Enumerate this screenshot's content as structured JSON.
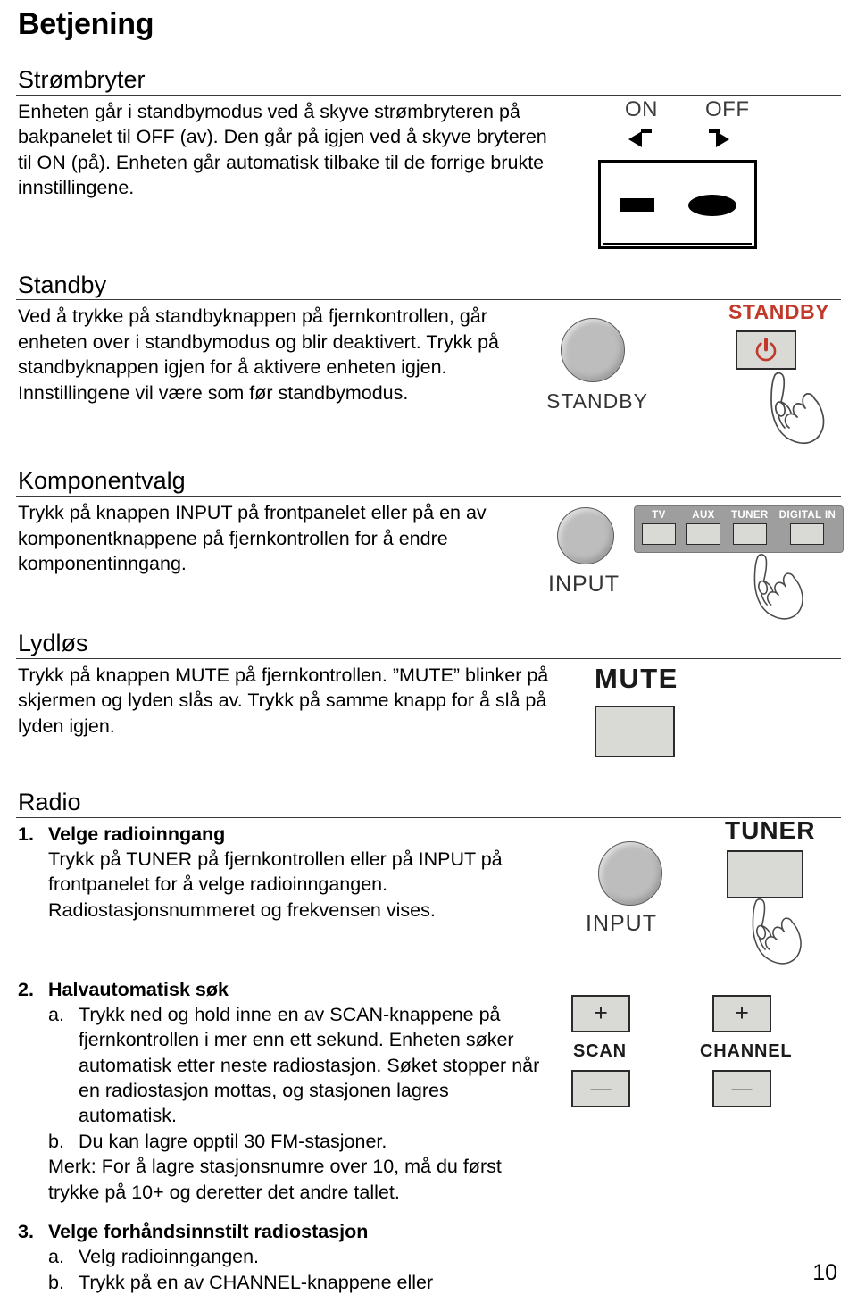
{
  "document": {
    "title": "Betjening",
    "page_number": "10"
  },
  "sections": [
    {
      "heading": "Strømbryter",
      "paragraphs": [
        "Enheten går i standbymodus ved å skyve strømbryteren på bakpanelet til OFF (av). Den går på igjen ved å skyve bryteren til ON (på). Enheten går automatisk tilbake til de forrige brukte innstillingene."
      ]
    },
    {
      "heading": "Standby",
      "paragraphs": [
        "Ved å trykke på standbyknappen på fjernkontrollen, går enheten over i standbymodus og blir deaktivert. Trykk på standbyknappen igjen for å aktivere enheten igjen. Innstillingene vil være som før standbymodus."
      ]
    },
    {
      "heading": "Komponentvalg",
      "paragraphs": [
        "Trykk på knappen INPUT på frontpanelet eller på en av komponentknappene på fjernkontrollen for å endre komponentinngang."
      ]
    },
    {
      "heading": "Lydløs",
      "paragraphs": [
        "Trykk på knappen MUTE på fjernkontrollen. ”MUTE” blinker på skjermen og lyden slås av. Trykk på samme knapp for å slå på lyden igjen."
      ]
    },
    {
      "heading": "Radio"
    }
  ],
  "radio": {
    "item1": {
      "marker": "1.",
      "title": "Velge radioinngang",
      "body": "Trykk på TUNER på fjernkontrollen eller på INPUT på frontpanelet for å velge radioinngangen. Radiostasjonsnummeret og frekvensen vises."
    },
    "item2": {
      "marker": "2.",
      "title": "Halvautomatisk søk",
      "sub_a_marker": "a.",
      "sub_a": "Trykk ned og hold inne en av SCAN-knappene på fjernkontrollen i mer enn ett sekund. Enheten søker automatisk etter neste radiostasjon. Søket stopper når en radiostasjon mottas, og stasjonen lagres automatisk.",
      "sub_b_marker": "b.",
      "sub_b": "Du kan lagre opptil 30 FM-stasjoner.",
      "note": "Merk: For å lagre stasjonsnumre over 10, må du først trykke på 10+ og deretter det andre tallet."
    },
    "item3": {
      "marker": "3.",
      "title": "Velge forhåndsinnstilt radiostasjon",
      "sub_a_marker": "a.",
      "sub_a": "Velg radioinngangen.",
      "sub_b_marker": "b.",
      "sub_b": "Trykk på en av CHANNEL-knappene eller"
    }
  },
  "illustrations": {
    "power_switch": {
      "on_label": "ON",
      "off_label": "OFF"
    },
    "standby": {
      "knob_label": "STANDBY",
      "remote_label": "STANDBY",
      "power_icon": "power-icon"
    },
    "input": {
      "knob_label": "INPUT",
      "buttons": [
        "TV",
        "AUX",
        "TUNER",
        "DIGITAL IN"
      ]
    },
    "mute": {
      "label": "MUTE"
    },
    "tuner": {
      "knob_label": "INPUT",
      "button_label": "TUNER"
    },
    "scan_channel": {
      "scan_label": "SCAN",
      "channel_label": "CHANNEL",
      "plus": "+",
      "minus": "—"
    }
  },
  "colors": {
    "standby_red": "#c0392b",
    "rule": "#3a3a3a",
    "key_face": "#d9dad6",
    "knob": "#bdbdbd",
    "strip": "#9e9e9e"
  }
}
